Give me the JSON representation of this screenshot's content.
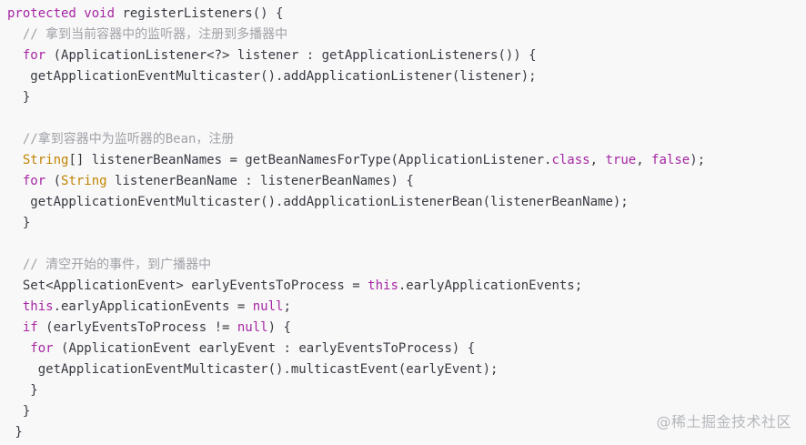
{
  "code": {
    "language": "java",
    "lines": [
      [
        {
          "t": "protected",
          "c": "kw"
        },
        {
          "t": " ",
          "c": "pl"
        },
        {
          "t": "void",
          "c": "kw"
        },
        {
          "t": " registerListeners() {",
          "c": "pl"
        }
      ],
      [
        {
          "t": "  // 拿到当前容器中的监听器，注册到多播器中",
          "c": "cm"
        }
      ],
      [
        {
          "t": "  ",
          "c": "pl"
        },
        {
          "t": "for",
          "c": "kw"
        },
        {
          "t": " (ApplicationListener<?> listener : getApplicationListeners()) {",
          "c": "pl"
        }
      ],
      [
        {
          "t": "   getApplicationEventMulticaster().addApplicationListener(listener);",
          "c": "pl"
        }
      ],
      [
        {
          "t": "  }",
          "c": "pl"
        }
      ],
      [],
      [
        {
          "t": "  //拿到容器中为监听器的Bean，注册",
          "c": "cm"
        }
      ],
      [
        {
          "t": "  ",
          "c": "pl"
        },
        {
          "t": "String",
          "c": "tp"
        },
        {
          "t": "[] listenerBeanNames = getBeanNamesForType(ApplicationListener.",
          "c": "pl"
        },
        {
          "t": "class",
          "c": "kw"
        },
        {
          "t": ", ",
          "c": "pl"
        },
        {
          "t": "true",
          "c": "kw"
        },
        {
          "t": ", ",
          "c": "pl"
        },
        {
          "t": "false",
          "c": "kw"
        },
        {
          "t": ");",
          "c": "pl"
        }
      ],
      [
        {
          "t": "  ",
          "c": "pl"
        },
        {
          "t": "for",
          "c": "kw"
        },
        {
          "t": " (",
          "c": "pl"
        },
        {
          "t": "String",
          "c": "tp"
        },
        {
          "t": " listenerBeanName : listenerBeanNames) {",
          "c": "pl"
        }
      ],
      [
        {
          "t": "   getApplicationEventMulticaster().addApplicationListenerBean(listenerBeanName);",
          "c": "pl"
        }
      ],
      [
        {
          "t": "  }",
          "c": "pl"
        }
      ],
      [],
      [
        {
          "t": "  // 清空开始的事件，到广播器中",
          "c": "cm"
        }
      ],
      [
        {
          "t": "  Set<ApplicationEvent> earlyEventsToProcess = ",
          "c": "pl"
        },
        {
          "t": "this",
          "c": "kw"
        },
        {
          "t": ".earlyApplicationEvents;",
          "c": "pl"
        }
      ],
      [
        {
          "t": "  ",
          "c": "pl"
        },
        {
          "t": "this",
          "c": "kw"
        },
        {
          "t": ".earlyApplicationEvents = ",
          "c": "pl"
        },
        {
          "t": "null",
          "c": "kw"
        },
        {
          "t": ";",
          "c": "pl"
        }
      ],
      [
        {
          "t": "  ",
          "c": "pl"
        },
        {
          "t": "if",
          "c": "kw"
        },
        {
          "t": " (earlyEventsToProcess != ",
          "c": "pl"
        },
        {
          "t": "null",
          "c": "kw"
        },
        {
          "t": ") {",
          "c": "pl"
        }
      ],
      [
        {
          "t": "   ",
          "c": "pl"
        },
        {
          "t": "for",
          "c": "kw"
        },
        {
          "t": " (ApplicationEvent earlyEvent : earlyEventsToProcess) {",
          "c": "pl"
        }
      ],
      [
        {
          "t": "    getApplicationEventMulticaster().multicastEvent(earlyEvent);",
          "c": "pl"
        }
      ],
      [
        {
          "t": "   }",
          "c": "pl"
        }
      ],
      [
        {
          "t": "  }",
          "c": "pl"
        }
      ],
      [
        {
          "t": " }",
          "c": "pl"
        }
      ]
    ]
  },
  "watermark": "@稀土掘金技术社区",
  "colors": {
    "background": "#f8f8f8",
    "keyword": "#a626a4",
    "comment": "#a0a1a7",
    "type": "#c18401",
    "plain": "#383a42"
  }
}
